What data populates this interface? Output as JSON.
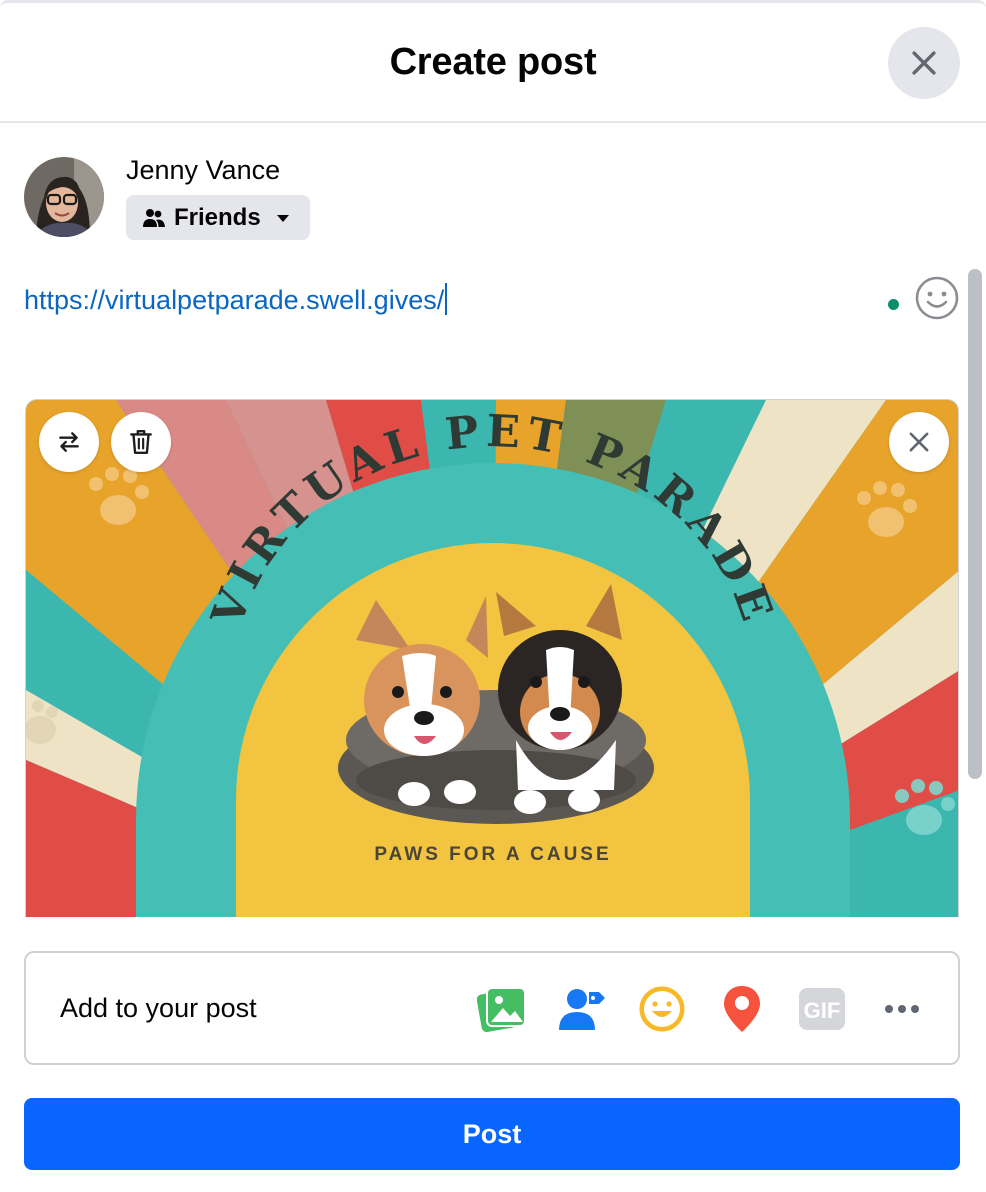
{
  "header": {
    "title": "Create post"
  },
  "user": {
    "name": "Jenny Vance",
    "audience": "Friends"
  },
  "composer": {
    "text": "https://virtualpetparade.swell.gives/"
  },
  "preview": {
    "heading": "VIRTUAL PET PARADE",
    "tagline": "PAWS FOR A CAUSE"
  },
  "add_bar": {
    "label": "Add to your post",
    "tools": [
      "photo-video-icon",
      "tag-people-icon",
      "feeling-icon",
      "check-in-icon",
      "gif-icon",
      "more-icon"
    ],
    "gif_label": "GIF"
  },
  "post_button": {
    "label": "Post"
  },
  "colors": {
    "accent": "#0866ff",
    "link": "#0a66c2",
    "photo": "#45bd62",
    "tag": "#1877f2",
    "feeling": "#f7b928",
    "checkin": "#f5533d"
  }
}
